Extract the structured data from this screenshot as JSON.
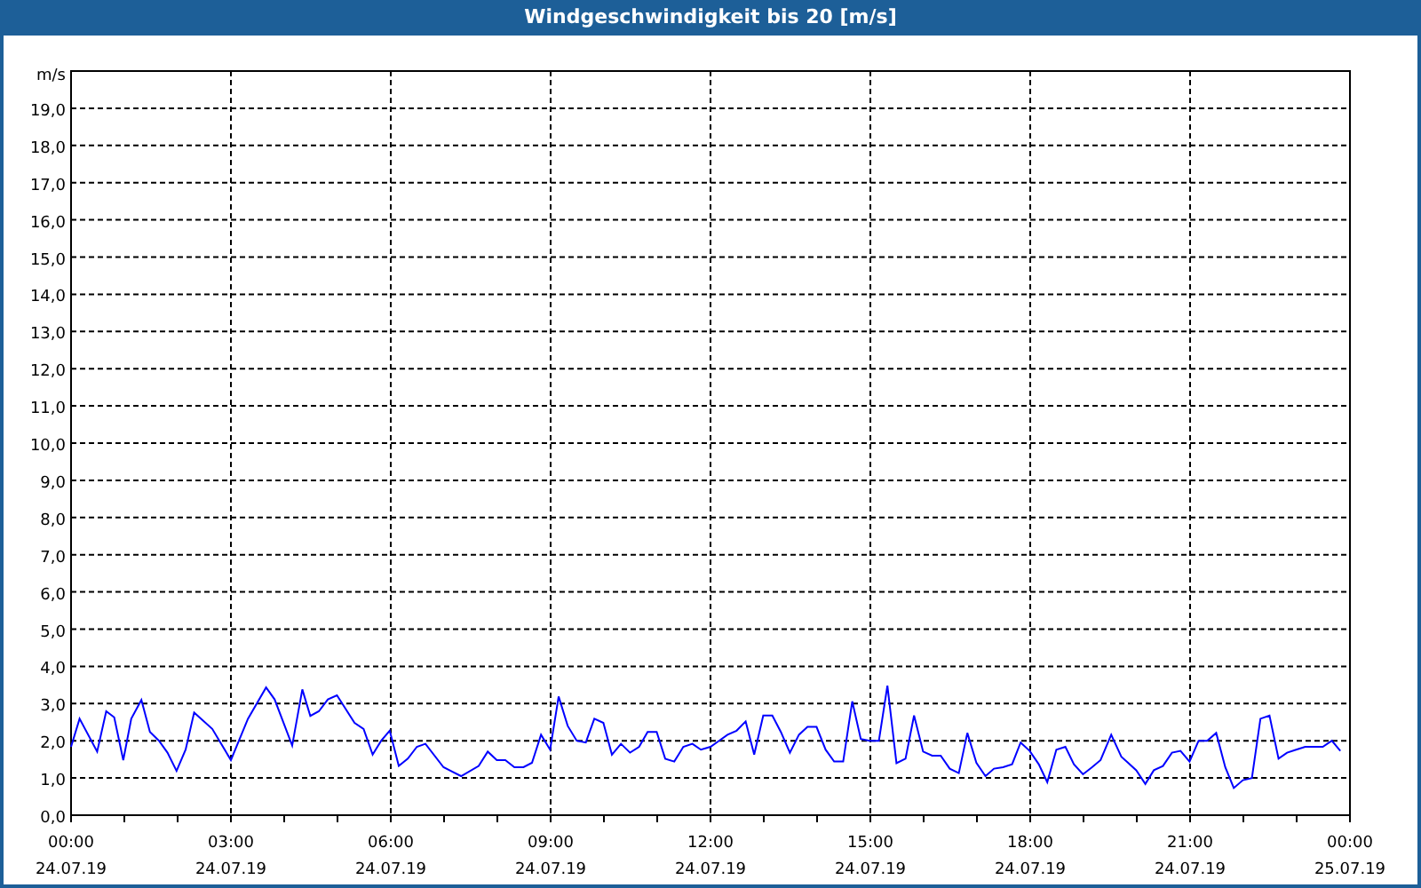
{
  "window": {
    "title": "Windgeschwindigkeit bis 20 [m/s]"
  },
  "chart": {
    "tick_dates": [
      "24.07.19",
      "24.07.19",
      "24.07.19",
      "24.07.19",
      "24.07.19",
      "24.07.19",
      "24.07.19",
      "24.07.19",
      "25.07.19"
    ],
    "chart_data": {
      "type": "line",
      "ylabel": "m/s",
      "xlim": [
        0,
        24
      ],
      "ylim": [
        0,
        20
      ],
      "grid": true,
      "xticks": [
        {
          "value": 0,
          "label": "00:00"
        },
        {
          "value": 3,
          "label": "03:00"
        },
        {
          "value": 6,
          "label": "06:00"
        },
        {
          "value": 9,
          "label": "09:00"
        },
        {
          "value": 12,
          "label": "12:00"
        },
        {
          "value": 15,
          "label": "15:00"
        },
        {
          "value": 18,
          "label": "18:00"
        },
        {
          "value": 21,
          "label": "21:00"
        },
        {
          "value": 24,
          "label": "00:00"
        }
      ],
      "yticks": [
        {
          "value": 0,
          "label": "0,0"
        },
        {
          "value": 1,
          "label": "1,0"
        },
        {
          "value": 2,
          "label": "2,0"
        },
        {
          "value": 3,
          "label": "3,0"
        },
        {
          "value": 4,
          "label": "4,0"
        },
        {
          "value": 5,
          "label": "5,0"
        },
        {
          "value": 6,
          "label": "6,0"
        },
        {
          "value": 7,
          "label": "7,0"
        },
        {
          "value": 8,
          "label": "8,0"
        },
        {
          "value": 9,
          "label": "9,0"
        },
        {
          "value": 10,
          "label": "10,0"
        },
        {
          "value": 11,
          "label": "11,0"
        },
        {
          "value": 12,
          "label": "12,0"
        },
        {
          "value": 13,
          "label": "13,0"
        },
        {
          "value": 14,
          "label": "14,0"
        },
        {
          "value": 15,
          "label": "15,0"
        },
        {
          "value": 16,
          "label": "16,0"
        },
        {
          "value": 17,
          "label": "17,0"
        },
        {
          "value": 18,
          "label": "18,0"
        },
        {
          "value": 19,
          "label": "19,0"
        }
      ],
      "x": [
        0,
        0.16,
        0.49,
        0.66,
        0.81,
        0.98,
        1.13,
        1.32,
        1.48,
        1.65,
        1.81,
        1.98,
        2.15,
        2.31,
        2.65,
        3.0,
        3.32,
        3.66,
        3.82,
        4.15,
        4.34,
        4.49,
        4.65,
        4.82,
        4.99,
        5.32,
        5.49,
        5.66,
        5.82,
        5.98,
        6.15,
        6.32,
        6.49,
        6.65,
        6.99,
        7.32,
        7.65,
        7.82,
        7.99,
        8.15,
        8.32,
        8.49,
        8.65,
        8.82,
        8.99,
        9.15,
        9.32,
        9.49,
        9.66,
        9.82,
        9.99,
        10.15,
        10.32,
        10.49,
        10.66,
        10.82,
        10.99,
        11.15,
        11.32,
        11.49,
        11.66,
        11.82,
        12.0,
        12.16,
        12.32,
        12.49,
        12.66,
        12.82,
        12.99,
        13.16,
        13.32,
        13.49,
        13.66,
        13.82,
        13.99,
        14.16,
        14.32,
        14.49,
        14.66,
        14.82,
        14.99,
        15.16,
        15.32,
        15.49,
        15.66,
        15.82,
        15.99,
        16.16,
        16.32,
        16.49,
        16.66,
        16.82,
        16.99,
        17.16,
        17.32,
        17.49,
        17.66,
        17.82,
        17.99,
        18.16,
        18.32,
        18.49,
        18.66,
        18.82,
        18.99,
        19.16,
        19.32,
        19.52,
        19.71,
        19.99,
        20.16,
        20.32,
        20.49,
        20.66,
        20.82,
        20.99,
        21.16,
        21.32,
        21.49,
        21.66,
        21.82,
        21.99,
        22.16,
        22.32,
        22.49,
        22.66,
        22.82,
        22.99,
        23.16,
        23.32,
        23.49,
        23.66,
        23.82
      ],
      "series": [
        {
          "color": "#0000ff",
          "values": [
            1.84,
            2.59,
            1.71,
            2.79,
            2.63,
            1.48,
            2.59,
            3.1,
            2.24,
            2.0,
            1.68,
            1.19,
            1.76,
            2.76,
            2.32,
            1.48,
            2.59,
            3.43,
            3.11,
            1.87,
            3.38,
            2.67,
            2.79,
            3.11,
            3.22,
            2.48,
            2.32,
            1.63,
            2.0,
            2.27,
            1.32,
            1.52,
            1.84,
            1.92,
            1.29,
            1.05,
            1.32,
            1.71,
            1.48,
            1.48,
            1.29,
            1.29,
            1.41,
            2.16,
            1.76,
            3.19,
            2.4,
            2.0,
            1.95,
            2.59,
            2.48,
            1.63,
            1.92,
            1.68,
            1.84,
            2.24,
            2.24,
            1.52,
            1.44,
            1.84,
            1.92,
            1.76,
            1.84,
            2.0,
            2.16,
            2.27,
            2.52,
            1.63,
            2.68,
            2.68,
            2.24,
            1.68,
            2.16,
            2.37,
            2.37,
            1.76,
            1.44,
            1.44,
            3.06,
            2.05,
            2.0,
            2.0,
            3.48,
            1.4,
            1.52,
            2.68,
            1.71,
            1.6,
            1.6,
            1.25,
            1.13,
            2.21,
            1.41,
            1.05,
            1.25,
            1.29,
            1.37,
            1.95,
            1.73,
            1.37,
            0.89,
            1.76,
            1.84,
            1.37,
            1.1,
            1.29,
            1.48,
            2.16,
            1.57,
            1.21,
            0.84,
            1.21,
            1.32,
            1.68,
            1.73,
            1.44,
            2.0,
            2.0,
            2.21,
            1.29,
            0.73,
            0.94,
            1.0,
            2.59,
            2.68,
            1.52,
            1.68,
            1.76,
            1.84,
            1.84,
            1.84,
            2.0,
            1.73
          ]
        }
      ]
    }
  }
}
